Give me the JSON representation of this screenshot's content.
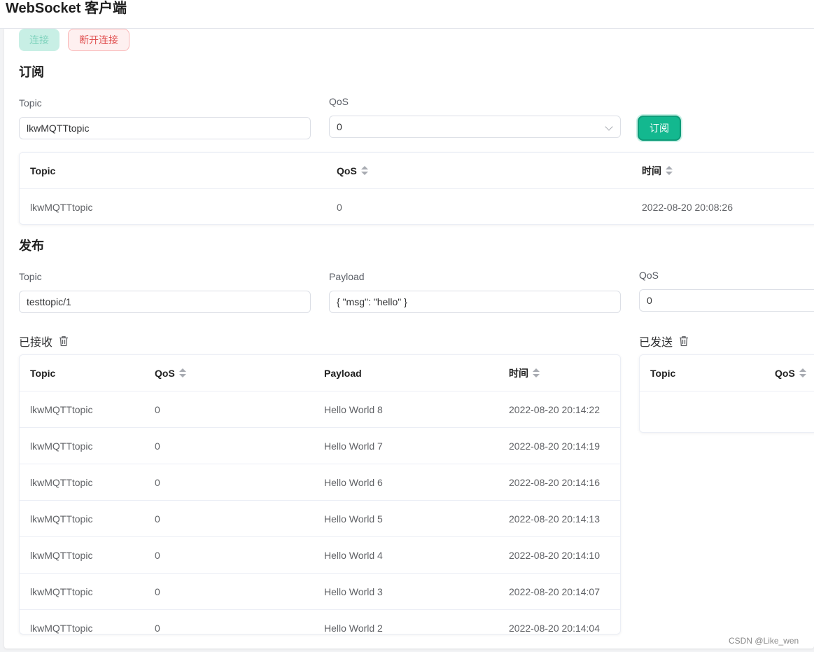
{
  "app": {
    "title": "WebSocket 客户端"
  },
  "connection": {
    "connect_label": "连接",
    "disconnect_label": "断开连接"
  },
  "subscribe": {
    "section_title": "订阅",
    "topic_label": "Topic",
    "topic_value": "lkwMQTTtopic",
    "qos_label": "QoS",
    "qos_value": "0",
    "button_label": "订阅",
    "table": {
      "headers": [
        "Topic",
        "QoS",
        "时间"
      ],
      "rows": [
        {
          "topic": "lkwMQTTtopic",
          "qos": "0",
          "time": "2022-08-20 20:08:26"
        }
      ]
    }
  },
  "publish": {
    "section_title": "发布",
    "topic_label": "Topic",
    "topic_value": "testtopic/1",
    "payload_label": "Payload",
    "payload_value": "{ \"msg\": \"hello\" }",
    "qos_label": "QoS",
    "qos_value": "0"
  },
  "received": {
    "title": "已接收",
    "headers": [
      "Topic",
      "QoS",
      "Payload",
      "时间"
    ],
    "rows": [
      {
        "topic": "lkwMQTTtopic",
        "qos": "0",
        "payload": "Hello World 8",
        "time": "2022-08-20 20:14:22"
      },
      {
        "topic": "lkwMQTTtopic",
        "qos": "0",
        "payload": "Hello World 7",
        "time": "2022-08-20 20:14:19"
      },
      {
        "topic": "lkwMQTTtopic",
        "qos": "0",
        "payload": "Hello World 6",
        "time": "2022-08-20 20:14:16"
      },
      {
        "topic": "lkwMQTTtopic",
        "qos": "0",
        "payload": "Hello World 5",
        "time": "2022-08-20 20:14:13"
      },
      {
        "topic": "lkwMQTTtopic",
        "qos": "0",
        "payload": "Hello World 4",
        "time": "2022-08-20 20:14:10"
      },
      {
        "topic": "lkwMQTTtopic",
        "qos": "0",
        "payload": "Hello World 3",
        "time": "2022-08-20 20:14:07"
      },
      {
        "topic": "lkwMQTTtopic",
        "qos": "0",
        "payload": "Hello World 2",
        "time": "2022-08-20 20:14:04"
      }
    ]
  },
  "sent": {
    "title": "已发送",
    "headers": [
      "Topic",
      "QoS"
    ]
  },
  "watermark": "CSDN @Like_wen",
  "colors": {
    "accent": "#13b88f",
    "danger": "#e04f4f",
    "connect_disabled_bg": "#c8efe5"
  },
  "icons": {
    "trash": "trash-icon",
    "chevron": "chevron-down-icon",
    "sort": "sort-caret-icon"
  }
}
